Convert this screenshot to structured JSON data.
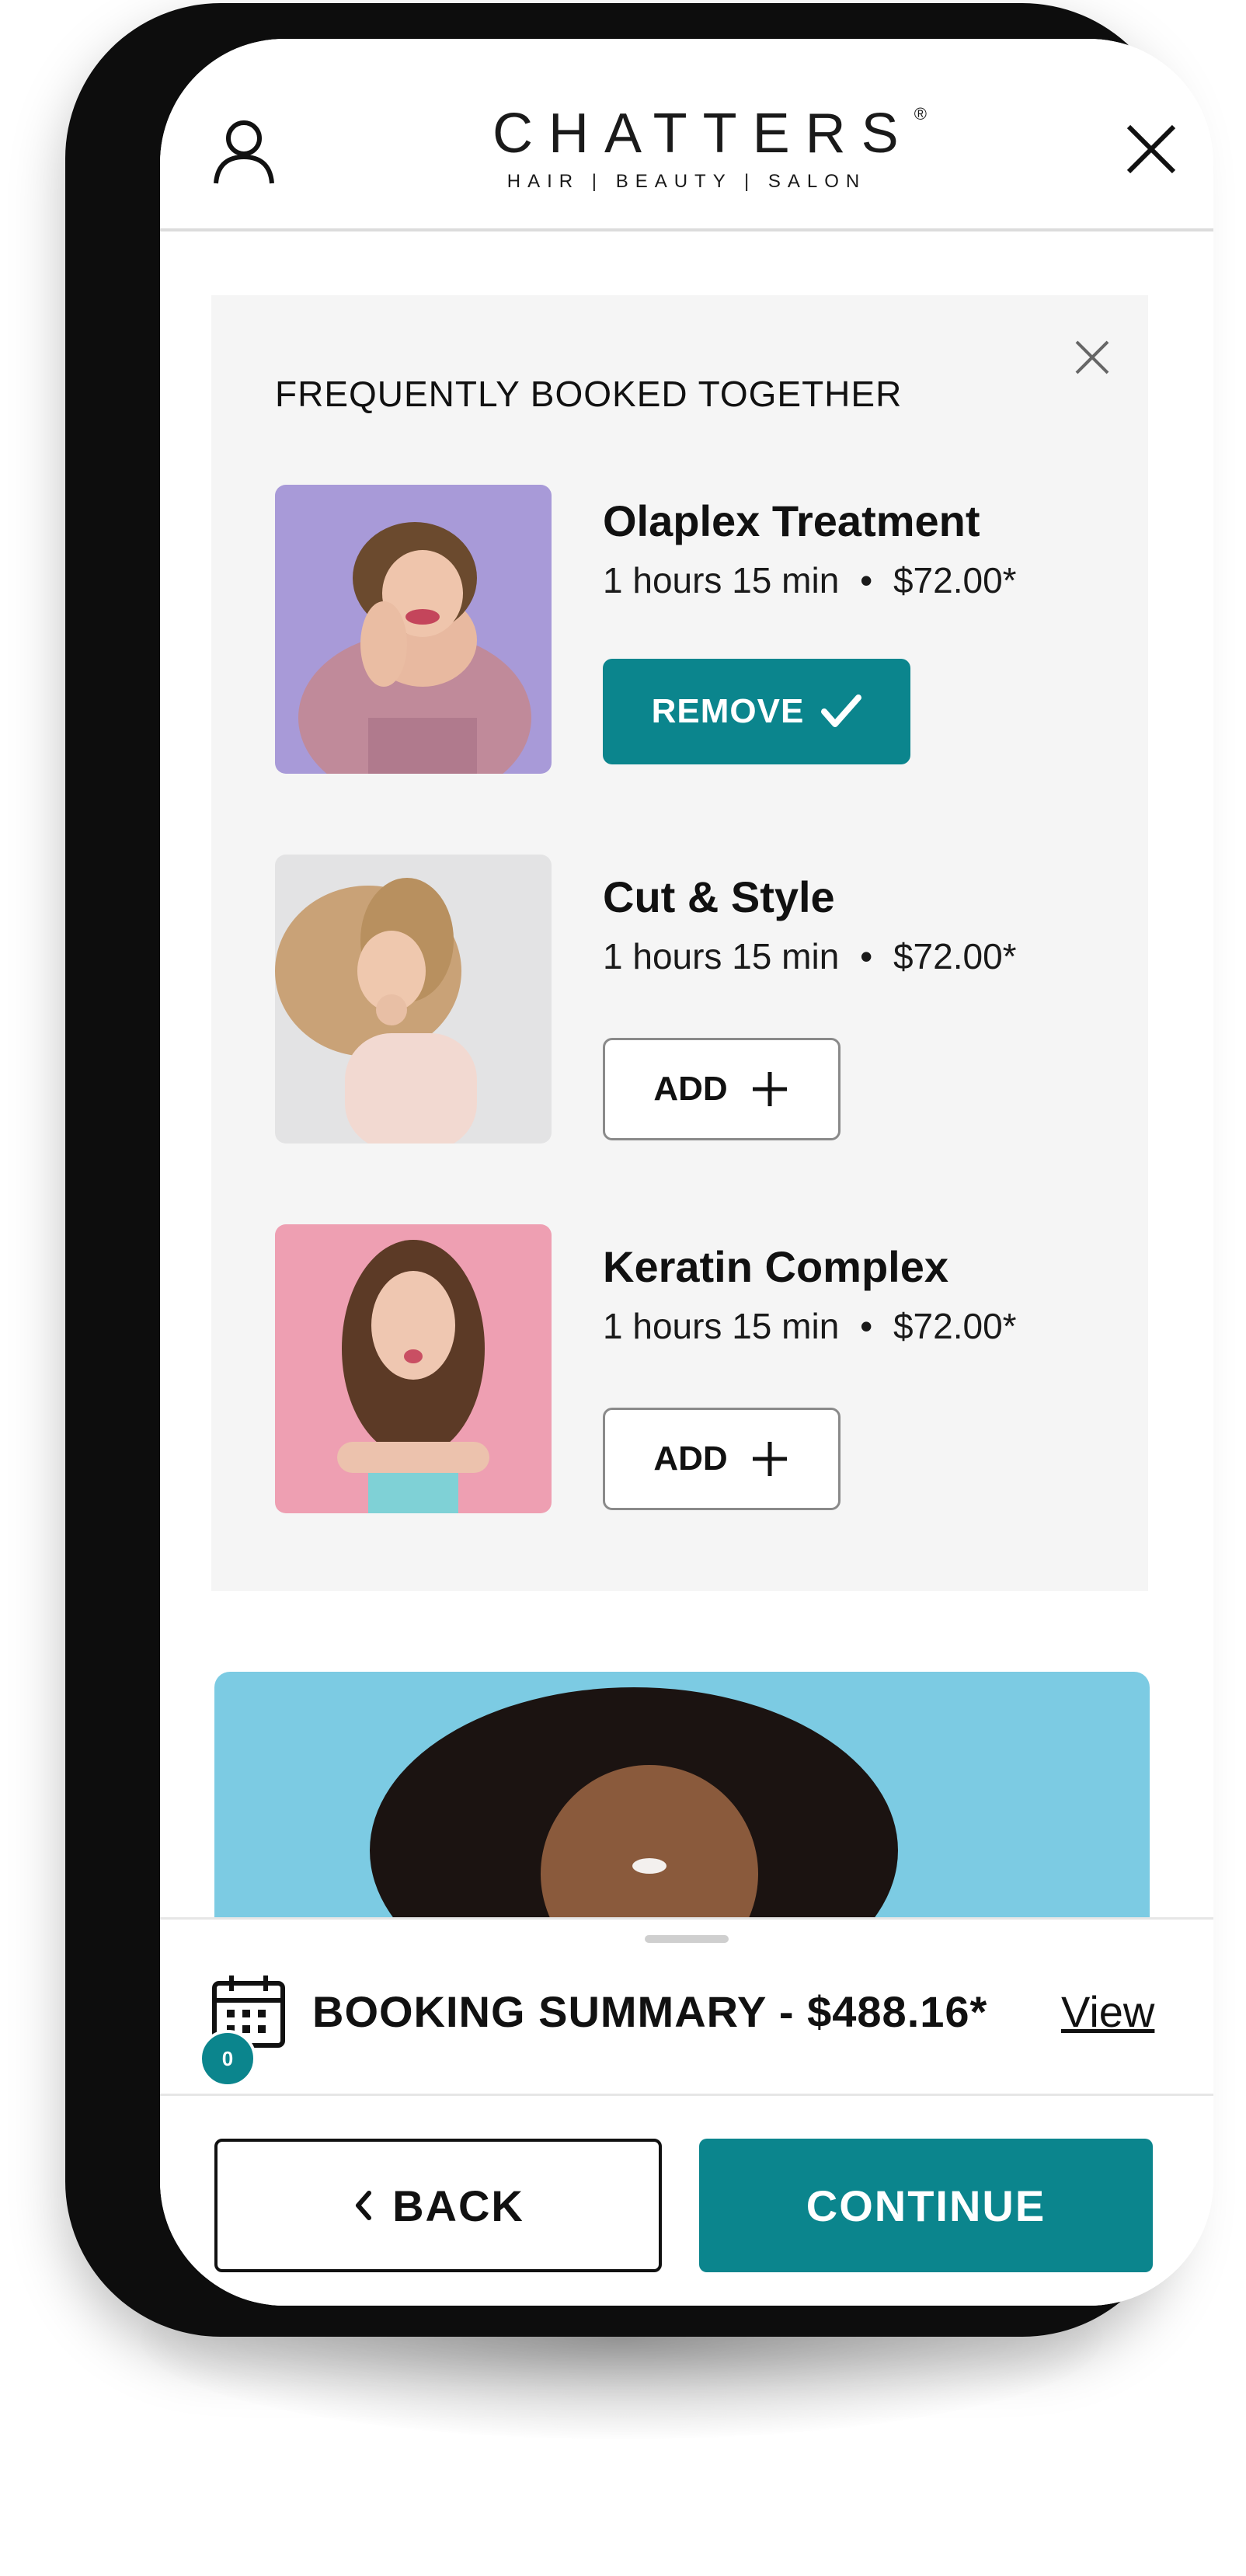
{
  "brand": {
    "name": "CHATTERS",
    "registered": "®",
    "tagline": "HAIR | BEAUTY | SALON"
  },
  "colors": {
    "accent": "#0b858d",
    "panel_bg": "#f5f5f5",
    "text": "#111111"
  },
  "icons": {
    "account": "account-icon",
    "close": "close-icon",
    "check": "check-icon",
    "plus": "plus-icon",
    "calendar": "calendar-icon",
    "chevron_left": "chevron-left-icon"
  },
  "recommendations": {
    "title": "FREQUENTLY BOOKED TOGETHER",
    "items": [
      {
        "name": "Olaplex Treatment",
        "duration": "1 hours 15 min",
        "price": "$72.00*",
        "action": "REMOVE",
        "selected": true
      },
      {
        "name": "Cut & Style",
        "duration": "1 hours 15 min",
        "price": "$72.00*",
        "action": "ADD",
        "selected": false
      },
      {
        "name": "Keratin Complex",
        "duration": "1 hours 15 min",
        "price": "$72.00*",
        "action": "ADD",
        "selected": false
      }
    ],
    "separator": "•"
  },
  "summary": {
    "label": "BOOKING SUMMARY - $488.16*",
    "badge_count": "0",
    "view_label": "View"
  },
  "footer": {
    "back_label": "BACK",
    "continue_label": "CONTINUE"
  }
}
